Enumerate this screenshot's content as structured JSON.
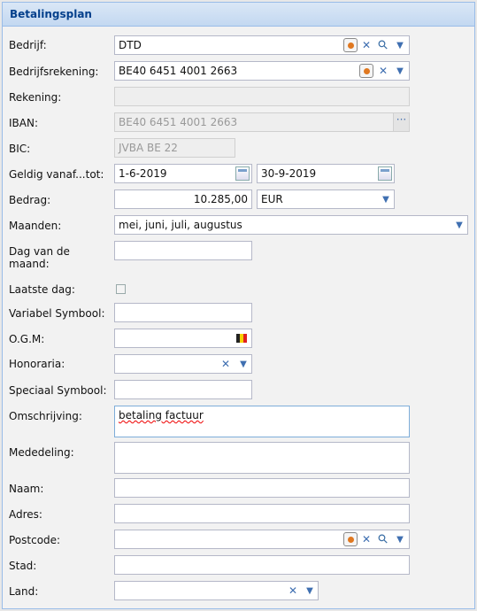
{
  "panel": {
    "title": "Betalingsplan"
  },
  "fields": {
    "bedrijf": {
      "label": "Bedrijf:",
      "value": "DTD"
    },
    "bedrijfsrekening": {
      "label": "Bedrijfsrekening:",
      "value": "BE40 6451 4001 2663"
    },
    "rekening": {
      "label": "Rekening:",
      "value": ""
    },
    "iban": {
      "label": "IBAN:",
      "value": "BE40 6451 4001 2663"
    },
    "bic": {
      "label": "BIC:",
      "value": "JVBA BE 22"
    },
    "geldig": {
      "label": "Geldig vanaf...tot:",
      "from": "1-6-2019",
      "to": "30-9-2019"
    },
    "bedrag": {
      "label": "Bedrag:",
      "value": "10.285,00",
      "currency": "EUR"
    },
    "maanden": {
      "label": "Maanden:",
      "value": "mei, juni, juli, augustus"
    },
    "dag": {
      "label_line1": "Dag van de",
      "label_line2": "maand:",
      "value": ""
    },
    "laatste_dag": {
      "label": "Laatste dag:",
      "checked": false
    },
    "variabel": {
      "label": "Variabel Symbool:",
      "value": ""
    },
    "ogm": {
      "label": "O.G.M:",
      "value": ""
    },
    "honoraria": {
      "label": "Honoraria:",
      "value": ""
    },
    "speciaal": {
      "label": "Speciaal Symbool:",
      "value": ""
    },
    "omschrijving": {
      "label": "Omschrijving:",
      "value": "betaling factuur"
    },
    "mededeling": {
      "label": "Mededeling:",
      "value": ""
    },
    "naam": {
      "label": "Naam:",
      "value": ""
    },
    "adres": {
      "label": "Adres:",
      "value": ""
    },
    "postcode": {
      "label": "Postcode:",
      "value": ""
    },
    "stad": {
      "label": "Stad:",
      "value": ""
    },
    "land": {
      "label": "Land:",
      "value": ""
    }
  },
  "glyphs": {
    "clear": "✕",
    "dropdown": "▼",
    "search": "⚲",
    "ellipsis": "···"
  },
  "colors": {
    "title_text": "#04408c",
    "header_bg": "#c3d8f1",
    "border": "#99bce8",
    "icon_blue": "#3f6fb1"
  }
}
